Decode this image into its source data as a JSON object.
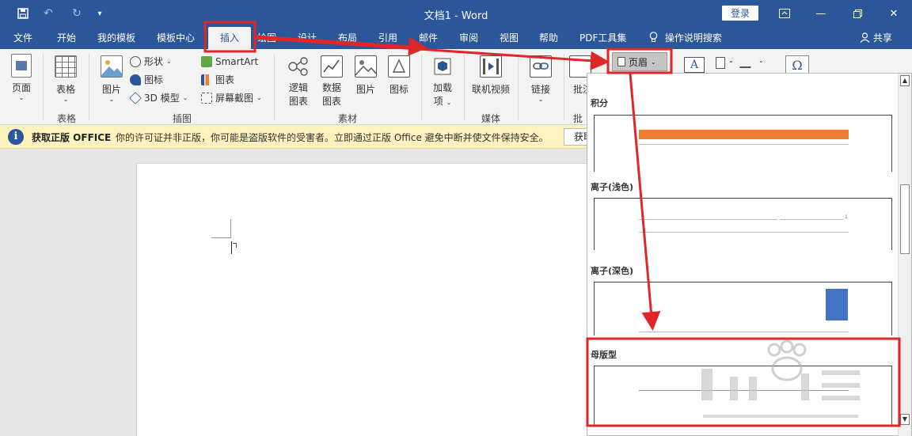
{
  "app": {
    "doc_title": "文档1",
    "app_name": "Word",
    "title_separator": " - ",
    "login_label": "登录"
  },
  "tabs": [
    {
      "label": "文件"
    },
    {
      "label": "开始"
    },
    {
      "label": "我的模板"
    },
    {
      "label": "模板中心"
    },
    {
      "label": "插入",
      "active": true
    },
    {
      "label": "绘图"
    },
    {
      "label": "设计"
    },
    {
      "label": "布局"
    },
    {
      "label": "引用"
    },
    {
      "label": "邮件"
    },
    {
      "label": "审阅"
    },
    {
      "label": "视图"
    },
    {
      "label": "帮助"
    },
    {
      "label": "PDF工具集"
    }
  ],
  "tell_me": "操作说明搜索",
  "share": "共享",
  "ribbon": {
    "page_btn": "页面",
    "table_btn": "表格",
    "picture_btn": "图片",
    "shapes": "形状",
    "icons": "图标",
    "model3d": "3D 模型",
    "smartart": "SmartArt",
    "chart": "图表",
    "screenshot": "屏幕截图",
    "logic_chart_1": "逻辑",
    "logic_chart_2": "图表",
    "data_chart_1": "数据",
    "data_chart_2": "图表",
    "picture2": "图片",
    "icons2": "图标",
    "addins_1": "加载",
    "addins_2": "项",
    "online_video": "联机视频",
    "link": "链接",
    "comment": "批注",
    "header_btn": "页眉",
    "groups": {
      "tables": "表格",
      "illustrations": "插图",
      "material": "素材",
      "media": "媒体",
      "comment": "批注"
    }
  },
  "notice": {
    "title": "获取正版 OFFICE",
    "message": "你的许可证并非正版，你可能是盗版软件的受害者。立即通过正版 Office 避免中断并使文件保持安全。",
    "button": "获取"
  },
  "gallery": {
    "items": [
      {
        "label": "积分"
      },
      {
        "label": "离子(浅色)"
      },
      {
        "label": "离子(深色)"
      },
      {
        "label": "母版型"
      }
    ],
    "preview_page_number": "1"
  },
  "colors": {
    "brand": "#2b579a",
    "annotation_red": "#e02626",
    "orange_bar": "#ed7d31",
    "blue_block": "#4472c4",
    "notice_bg": "#fdf1bd"
  }
}
